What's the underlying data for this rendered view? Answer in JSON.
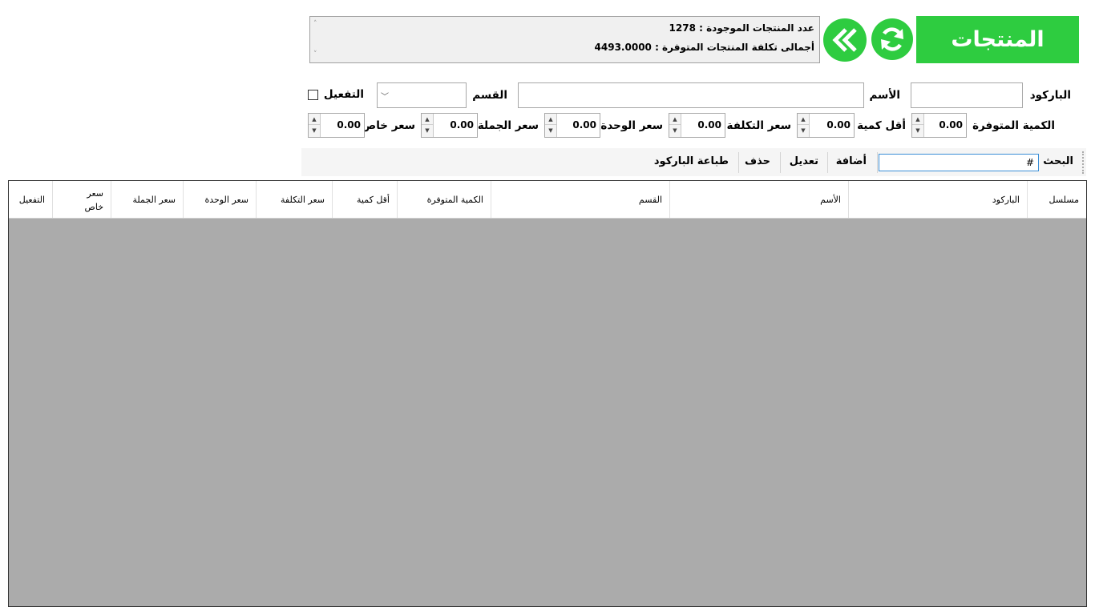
{
  "header": {
    "title": "المنتجات",
    "products_count_line": "عدد المنتجات الموجودة : 1278",
    "total_cost_line": "أجمالى تكلفة المنتجات المتوفرة : 4493.0000"
  },
  "form": {
    "barcode_label": "الباركود",
    "name_label": "الأسم",
    "category_label": "القسم",
    "active_label": "التفعيل",
    "qty_available_label": "الكمية المتوفرة",
    "qty_available_value": "0.00",
    "min_qty_label": "أقل كمية",
    "min_qty_value": "0.00",
    "cost_price_label": "سعر التكلفة",
    "cost_price_value": "0.00",
    "unit_price_label": "سعر الوحدة",
    "unit_price_value": "0.00",
    "wholesale_price_label": "سعر الجملة",
    "wholesale_price_value": "0.00",
    "special_price_label": "سعر خاص",
    "special_price_value": "0.00"
  },
  "toolbar": {
    "search_label": "البحث",
    "search_value": "#",
    "add_label": "أضافة",
    "edit_label": "تعديل",
    "delete_label": "حذف",
    "print_barcode_label": "طباعة الباركود"
  },
  "grid": {
    "columns": [
      "مسلسل",
      "الباركود",
      "الأسم",
      "القسم",
      "الكمية المتوفرة",
      "أقل كمية",
      "سعر التكلفة",
      "سعر الوحدة",
      "سعر الجملة",
      "سعر خاص",
      "التفعيل"
    ]
  },
  "colors": {
    "accent": "#2ecc40",
    "grid_background": "#ababab"
  }
}
